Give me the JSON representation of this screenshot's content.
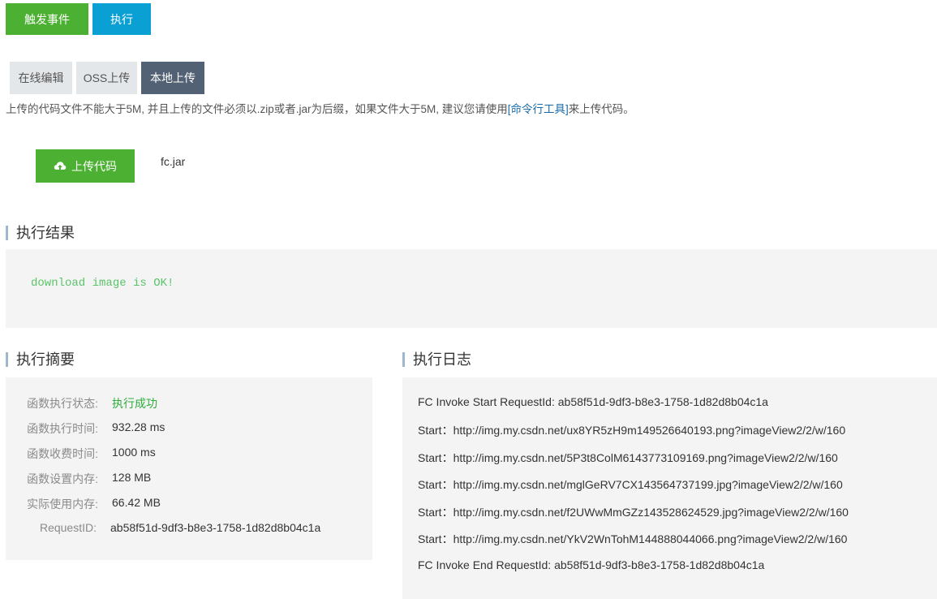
{
  "toolbar": {
    "trigger_label": "触发事件",
    "run_label": "执行"
  },
  "tabs": [
    {
      "label": "在线编辑",
      "active": false
    },
    {
      "label": "OSS上传",
      "active": false
    },
    {
      "label": "本地上传",
      "active": true
    }
  ],
  "upload": {
    "note_prefix": "上传的代码文件不能大于5M, 并且上传的文件必须以.zip或者.jar为后缀，如果文件大于5M, 建议您请使用",
    "note_link": "[命令行工具]",
    "note_suffix": "来上传代码。",
    "button_label": "上传代码",
    "button_icon": "cloud-upload-icon",
    "file_name": "fc.jar"
  },
  "result": {
    "title": "执行结果",
    "output": "download image is OK!"
  },
  "summary": {
    "title": "执行摘要",
    "rows": [
      {
        "key": "函数执行状态:",
        "value": "执行成功",
        "status": "success"
      },
      {
        "key": "函数执行时间:",
        "value": "932.28 ms"
      },
      {
        "key": "函数收费时间:",
        "value": "1000 ms"
      },
      {
        "key": "函数设置内存:",
        "value": "128 MB"
      },
      {
        "key": "实际使用内存:",
        "value": "66.42 MB"
      },
      {
        "key": "RequestID:",
        "value": "ab58f51d-9df3-b8e3-1758-1d82d8b04c1a"
      }
    ]
  },
  "log": {
    "title": "执行日志",
    "lines": [
      "FC Invoke Start RequestId: ab58f51d-9df3-b8e3-1758-1d82d8b04c1a",
      "Start：http://img.my.csdn.net/ux8YR5zH9m149526640193.png?imageView2/2/w/160",
      "Start：http://img.my.csdn.net/5P3t8ColM6143773109169.png?imageView2/2/w/160",
      "Start：http://img.my.csdn.net/mglGeRV7CX143564737199.jpg?imageView2/2/w/160",
      "Start：http://img.my.csdn.net/f2UWwMmGZz143528624529.jpg?imageView2/2/w/160",
      "Start：http://img.my.csdn.net/YkV2WnTohM144888044066.png?imageView2/2/w/160",
      "FC Invoke End RequestId: ab58f51d-9df3-b8e3-1758-1d82d8b04c1a"
    ]
  },
  "colors": {
    "primary_green": "#4cb033",
    "primary_blue": "#0aa0d3",
    "tab_active": "#526174",
    "success_text": "#2ead3b",
    "console_text": "#5bc36a",
    "panel_bg": "#f4f4f4"
  }
}
